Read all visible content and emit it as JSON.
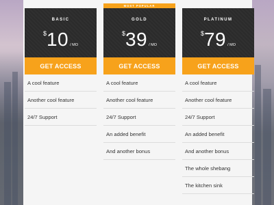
{
  "colors": {
    "accent": "#f7a21b",
    "card_header": "#2b2b2b",
    "panel": "#f5f5f5"
  },
  "badge": "MOST POPULAR",
  "plans": [
    {
      "name": "BASIC",
      "currency": "$",
      "price": "10",
      "period": "/ MO",
      "cta": "GET ACCESS",
      "features": [
        "A cool feature",
        "Another cool feature",
        "24/7 Support"
      ]
    },
    {
      "name": "GOLD",
      "currency": "$",
      "price": "39",
      "period": "/ MO",
      "cta": "GET ACCESS",
      "features": [
        "A cool feature",
        "Another cool feature",
        "24/7 Support",
        "An added benefit",
        "And another bonus"
      ]
    },
    {
      "name": "PLATINUM",
      "currency": "$",
      "price": "79",
      "period": "/ MO",
      "cta": "GET ACCESS",
      "features": [
        "A cool feature",
        "Another cool feature",
        "24/7 Support",
        "An added benefit",
        "And another bonus",
        "The whole shebang",
        "The kitchen sink"
      ]
    }
  ]
}
